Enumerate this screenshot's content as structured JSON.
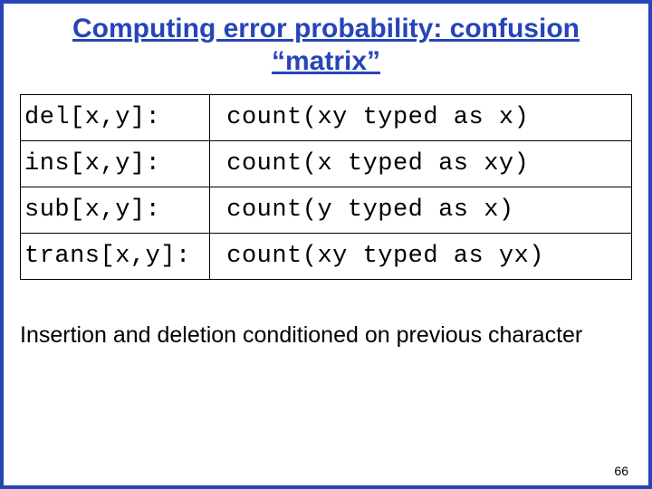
{
  "title": "Computing error probability: confusion “matrix”",
  "rows": [
    {
      "left": "del[x,y]:",
      "right": "count(xy typed as x)"
    },
    {
      "left": "ins[x,y]:",
      "right": "count(x typed as xy)"
    },
    {
      "left": "sub[x,y]:",
      "right": "count(y typed as x)"
    },
    {
      "left": "trans[x,y]:",
      "right": "count(xy typed as yx)"
    }
  ],
  "note": "Insertion and deletion conditioned on previous character",
  "page_number": "66"
}
